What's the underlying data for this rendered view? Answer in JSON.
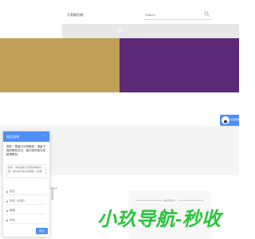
{
  "header": {
    "welcome_text": "大家都在搜：",
    "search_placeholder": "Search"
  },
  "banners": {
    "left_color": "#c1a05a",
    "right_color": "#5c2a78"
  },
  "service": {
    "label": "在线客服"
  },
  "section": {
    "big_letter": "T",
    "more_label": "MORE +"
  },
  "watermark": {
    "text": "小玖导航-秒收"
  },
  "chat": {
    "title": "留言咨询",
    "intro": "您好，很高兴为您服务，请留下您的联系方式，我们将尽快与您取得联系。",
    "message_placeholder": "您好，请在此输入您想咨询的内容，我们将尽快为您解答（必填）",
    "fields": [
      {
        "placeholder": "姓名"
      },
      {
        "placeholder": "电话（必填）"
      },
      {
        "placeholder": "邮箱"
      },
      {
        "placeholder": "地址"
      }
    ],
    "submit_label": "提交"
  }
}
